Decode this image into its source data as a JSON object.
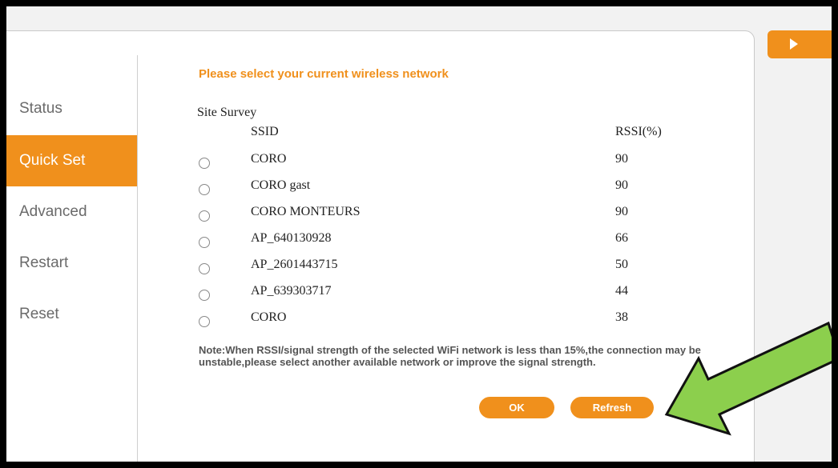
{
  "sidebar": {
    "items": [
      {
        "label": "Status"
      },
      {
        "label": "Quick Set"
      },
      {
        "label": "Advanced"
      },
      {
        "label": "Restart"
      },
      {
        "label": "Reset"
      }
    ],
    "active": "Quick Set"
  },
  "main": {
    "title": "Please select your current wireless network",
    "section_label": "Site Survey",
    "columns": {
      "ssid": "SSID",
      "rssi": "RSSI(%)"
    },
    "networks": [
      {
        "ssid": "CORO",
        "rssi": "90"
      },
      {
        "ssid": "CORO gast",
        "rssi": "90"
      },
      {
        "ssid": "CORO MONTEURS",
        "rssi": "90"
      },
      {
        "ssid": "AP_640130928",
        "rssi": "66"
      },
      {
        "ssid": "AP_2601443715",
        "rssi": "50"
      },
      {
        "ssid": "AP_639303717",
        "rssi": "44"
      },
      {
        "ssid": "CORO",
        "rssi": "38"
      }
    ],
    "note": "Note:When RSSI/signal strength of the selected WiFi network is less than 15%,the connection may be unstable,please select another available network or improve the signal strength.",
    "ok_label": "OK",
    "refresh_label": "Refresh"
  },
  "colors": {
    "accent": "#f0901c",
    "annotation_arrow": "#8ccf4d"
  },
  "icons": {
    "side_tab": "play-icon",
    "annotation": "arrow-icon"
  }
}
